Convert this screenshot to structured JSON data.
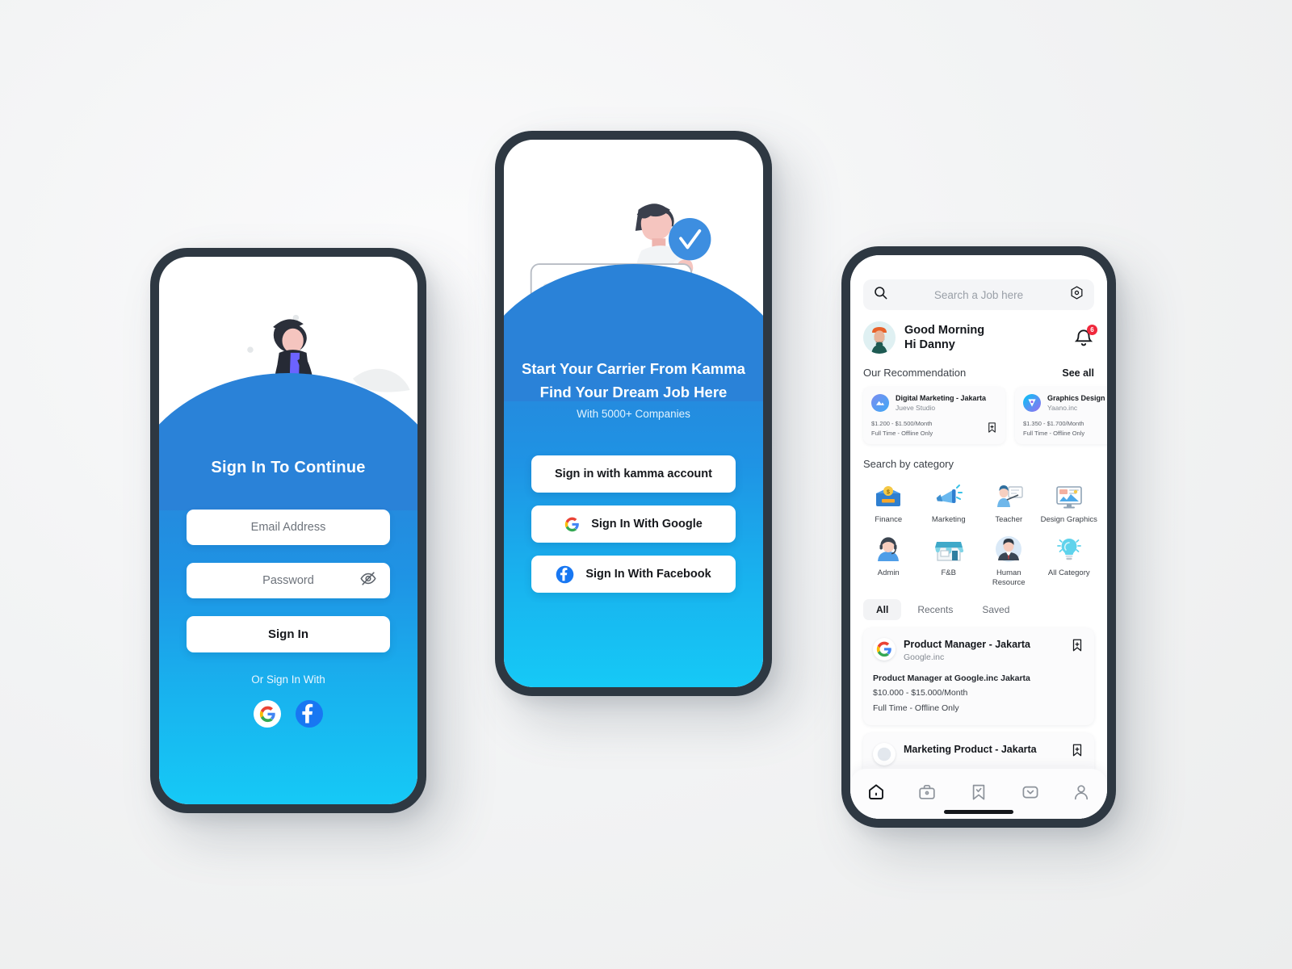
{
  "colors": {
    "gradient_top": "#2a82d8",
    "gradient_bottom": "#16c9f6",
    "frame": "#2e3842",
    "background": "#f1f2f3",
    "accent_blue": "#2a82d8",
    "badge_red": "#f0283c",
    "facebook_blue": "#1877f2"
  },
  "signin_screen": {
    "title": "Sign In To Continue",
    "email_placeholder": "Email Address",
    "password_placeholder": "Password",
    "password_toggle_icon": "eye-off-icon",
    "signin_button": "Sign In",
    "or_text": "Or Sign In With",
    "social": [
      {
        "name": "google",
        "icon": "google-icon"
      },
      {
        "name": "facebook",
        "icon": "facebook-icon"
      }
    ],
    "illustration": "walking-man-with-documents-illustration"
  },
  "onboarding_screen": {
    "headline_line1": "Start Your Carrier From Kamma",
    "headline_line2": "Find Your Dream Job Here",
    "subtitle": "With 5000+ Companies",
    "buttons": [
      {
        "label": "Sign in with kamma account",
        "icon": null
      },
      {
        "label": "Sign In With Google",
        "icon": "google-icon"
      },
      {
        "label": "Sign In With Facebook",
        "icon": "facebook-icon"
      }
    ],
    "illustration": "person-holding-form-card-with-check-badge"
  },
  "home_screen": {
    "search": {
      "placeholder": "Search a Job here",
      "left_icon": "search-icon",
      "right_icon": "filter-hex-icon"
    },
    "greeting": {
      "line1": "Good Morning",
      "line2": "Hi Danny",
      "avatar": "user-avatar",
      "notification_icon": "bell-icon",
      "notification_count": "6"
    },
    "recommendation": {
      "title": "Our Recommendation",
      "see_all": "See all",
      "cards": [
        {
          "title": "Digital Marketing - Jakarta",
          "company": "Jueve Studio",
          "salary": "$1.200 - $1.500/Month",
          "type": "Full Time - Offline Only",
          "logo": "jueve-studio-logo",
          "bookmark_icon": "bookmark-add-icon"
        },
        {
          "title": "Graphics Design",
          "company": "Yaano.inc",
          "salary": "$1.350 - $1.700/Month",
          "type": "Full Time - Offline Only",
          "logo": "yaano-inc-logo",
          "bookmark_icon": "bookmark-add-icon"
        }
      ]
    },
    "category": {
      "title": "Search by category",
      "items": [
        {
          "label": "Finance",
          "icon": "finance-money-icon"
        },
        {
          "label": "Marketing",
          "icon": "megaphone-icon"
        },
        {
          "label": "Teacher",
          "icon": "teacher-whiteboard-icon"
        },
        {
          "label": "Design Graphics",
          "icon": "design-monitor-icon"
        },
        {
          "label": "Admin",
          "icon": "admin-headset-icon"
        },
        {
          "label": "F&B",
          "icon": "storefront-icon"
        },
        {
          "label": "Human Resource",
          "icon": "businessman-icon"
        },
        {
          "label": "All Category",
          "icon": "lightbulb-icon"
        }
      ]
    },
    "tabs": [
      {
        "label": "All",
        "active": true
      },
      {
        "label": "Recents",
        "active": false
      },
      {
        "label": "Saved",
        "active": false
      }
    ],
    "jobs": [
      {
        "title": "Product Manager - Jakarta",
        "company": "Google.inc",
        "logo": "google-icon",
        "description": "Product Manager at Google.inc Jakarta",
        "salary": "$10.000 - $15.000/Month",
        "type": "Full Time - Offline Only",
        "bookmark_icon": "bookmark-add-icon"
      },
      {
        "title": "Marketing Product - Jakarta",
        "company": "",
        "logo": "company-logo",
        "description": "",
        "salary": "",
        "type": "",
        "bookmark_icon": "bookmark-add-icon"
      }
    ],
    "bottom_nav": [
      {
        "name": "home",
        "icon": "home-icon",
        "active": true
      },
      {
        "name": "jobs",
        "icon": "briefcase-icon",
        "active": false
      },
      {
        "name": "saved",
        "icon": "bookmark-check-icon",
        "active": false
      },
      {
        "name": "messages",
        "icon": "envelope-icon",
        "active": false
      },
      {
        "name": "profile",
        "icon": "person-icon",
        "active": false
      }
    ]
  }
}
